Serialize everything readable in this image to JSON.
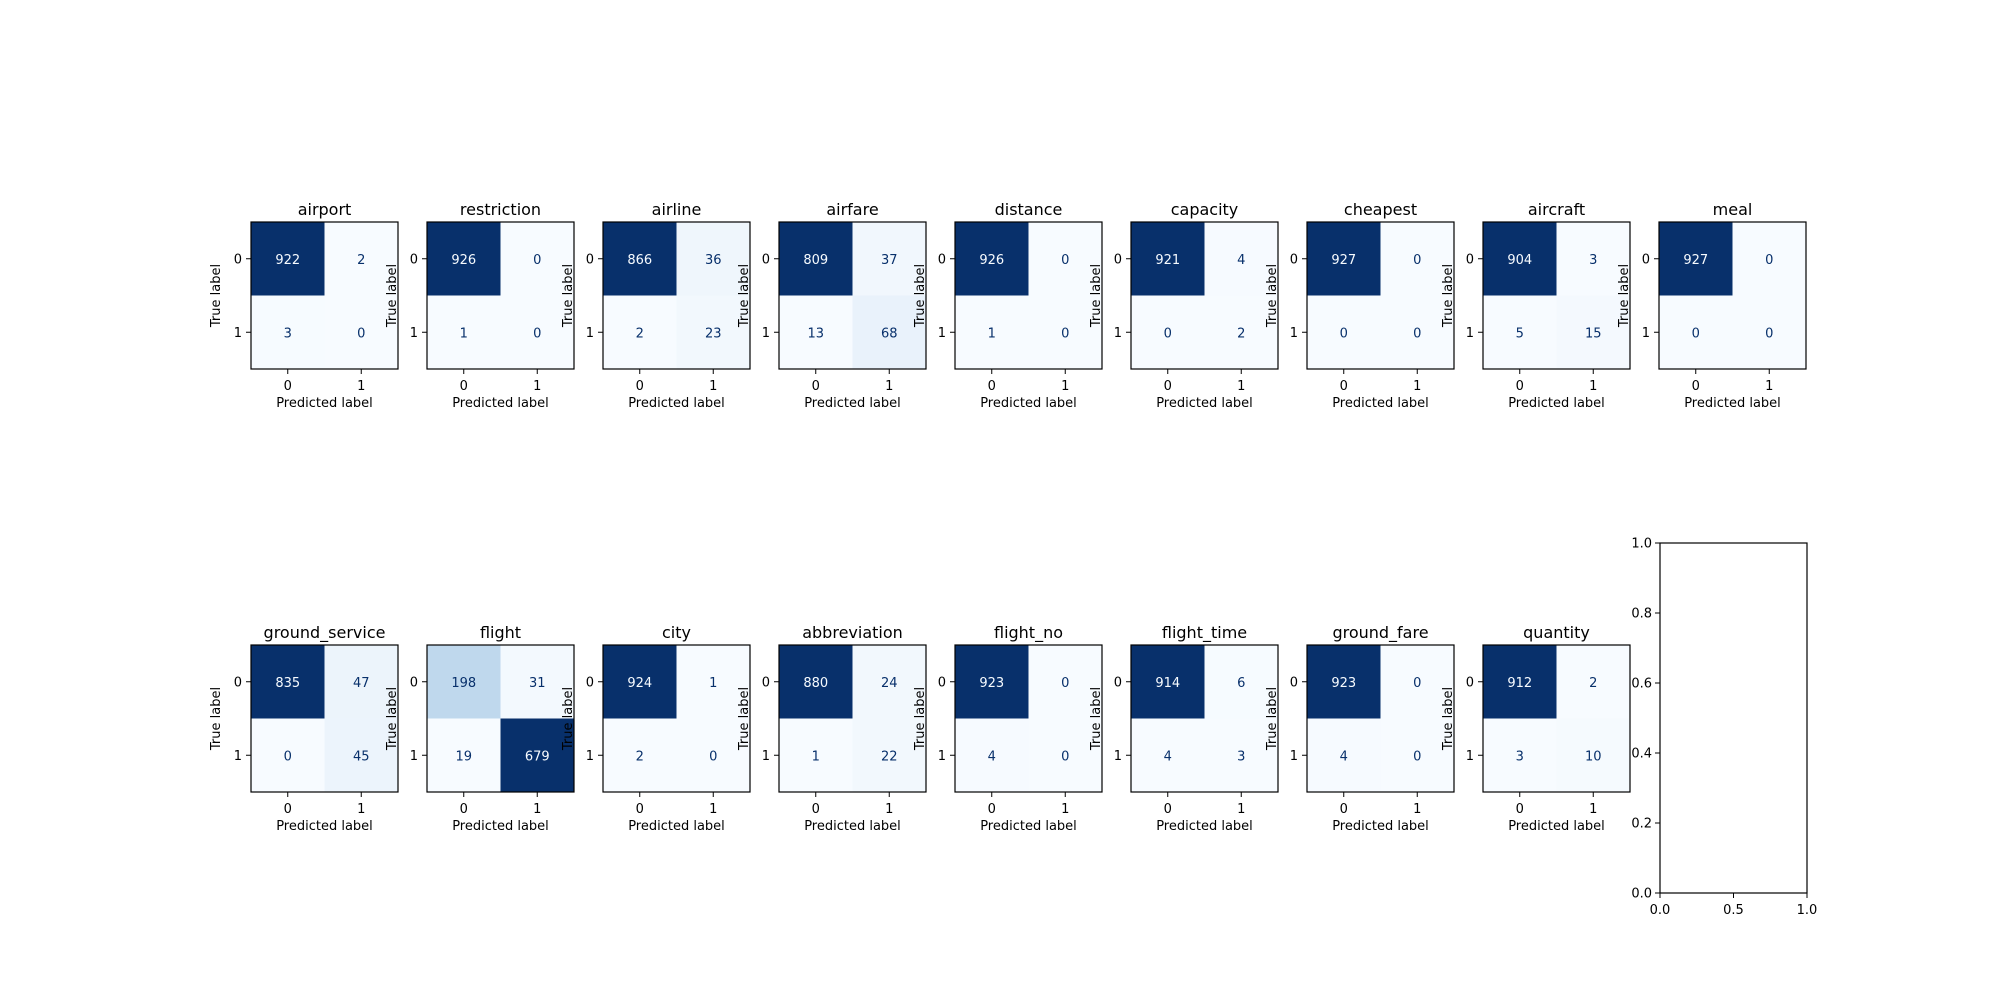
{
  "figure": {
    "colormap": "Blues",
    "cmap_low": "#f7fbff",
    "cmap_high": "#08306b",
    "text_dark": "#08306b",
    "text_light": "#f7fbff"
  },
  "chart_data": [
    {
      "type": "heatmap",
      "title": "airport",
      "xlabel": "Predicted label",
      "ylabel": "True label",
      "xticks": [
        "0",
        "1"
      ],
      "yticks": [
        "0",
        "1"
      ],
      "matrix": [
        [
          922,
          2
        ],
        [
          3,
          0
        ]
      ]
    },
    {
      "type": "heatmap",
      "title": "restriction",
      "xlabel": "Predicted label",
      "ylabel": "True label",
      "xticks": [
        "0",
        "1"
      ],
      "yticks": [
        "0",
        "1"
      ],
      "matrix": [
        [
          926,
          0
        ],
        [
          1,
          0
        ]
      ]
    },
    {
      "type": "heatmap",
      "title": "airline",
      "xlabel": "Predicted label",
      "ylabel": "True label",
      "xticks": [
        "0",
        "1"
      ],
      "yticks": [
        "0",
        "1"
      ],
      "matrix": [
        [
          866,
          36
        ],
        [
          2,
          23
        ]
      ]
    },
    {
      "type": "heatmap",
      "title": "airfare",
      "xlabel": "Predicted label",
      "ylabel": "True label",
      "xticks": [
        "0",
        "1"
      ],
      "yticks": [
        "0",
        "1"
      ],
      "matrix": [
        [
          809,
          37
        ],
        [
          13,
          68
        ]
      ]
    },
    {
      "type": "heatmap",
      "title": "distance",
      "xlabel": "Predicted label",
      "ylabel": "True label",
      "xticks": [
        "0",
        "1"
      ],
      "yticks": [
        "0",
        "1"
      ],
      "matrix": [
        [
          926,
          0
        ],
        [
          1,
          0
        ]
      ]
    },
    {
      "type": "heatmap",
      "title": "capacity",
      "xlabel": "Predicted label",
      "ylabel": "True label",
      "xticks": [
        "0",
        "1"
      ],
      "yticks": [
        "0",
        "1"
      ],
      "matrix": [
        [
          921,
          4
        ],
        [
          0,
          2
        ]
      ]
    },
    {
      "type": "heatmap",
      "title": "cheapest",
      "xlabel": "Predicted label",
      "ylabel": "True label",
      "xticks": [
        "0",
        "1"
      ],
      "yticks": [
        "0",
        "1"
      ],
      "matrix": [
        [
          927,
          0
        ],
        [
          0,
          0
        ]
      ]
    },
    {
      "type": "heatmap",
      "title": "aircraft",
      "xlabel": "Predicted label",
      "ylabel": "True label",
      "xticks": [
        "0",
        "1"
      ],
      "yticks": [
        "0",
        "1"
      ],
      "matrix": [
        [
          904,
          3
        ],
        [
          5,
          15
        ]
      ]
    },
    {
      "type": "heatmap",
      "title": "meal",
      "xlabel": "Predicted label",
      "ylabel": "True label",
      "xticks": [
        "0",
        "1"
      ],
      "yticks": [
        "0",
        "1"
      ],
      "matrix": [
        [
          927,
          0
        ],
        [
          0,
          0
        ]
      ]
    },
    {
      "type": "heatmap",
      "title": "ground_service",
      "xlabel": "Predicted label",
      "ylabel": "True label",
      "xticks": [
        "0",
        "1"
      ],
      "yticks": [
        "0",
        "1"
      ],
      "matrix": [
        [
          835,
          47
        ],
        [
          0,
          45
        ]
      ]
    },
    {
      "type": "heatmap",
      "title": "flight",
      "xlabel": "Predicted label",
      "ylabel": "True label",
      "xticks": [
        "0",
        "1"
      ],
      "yticks": [
        "0",
        "1"
      ],
      "matrix": [
        [
          198,
          31
        ],
        [
          19,
          679
        ]
      ]
    },
    {
      "type": "heatmap",
      "title": "city",
      "xlabel": "Predicted label",
      "ylabel": "True label",
      "xticks": [
        "0",
        "1"
      ],
      "yticks": [
        "0",
        "1"
      ],
      "matrix": [
        [
          924,
          1
        ],
        [
          2,
          0
        ]
      ]
    },
    {
      "type": "heatmap",
      "title": "abbreviation",
      "xlabel": "Predicted label",
      "ylabel": "True label",
      "xticks": [
        "0",
        "1"
      ],
      "yticks": [
        "0",
        "1"
      ],
      "matrix": [
        [
          880,
          24
        ],
        [
          1,
          22
        ]
      ]
    },
    {
      "type": "heatmap",
      "title": "flight_no",
      "xlabel": "Predicted label",
      "ylabel": "True label",
      "xticks": [
        "0",
        "1"
      ],
      "yticks": [
        "0",
        "1"
      ],
      "matrix": [
        [
          923,
          0
        ],
        [
          4,
          0
        ]
      ]
    },
    {
      "type": "heatmap",
      "title": "flight_time",
      "xlabel": "Predicted label",
      "ylabel": "True label",
      "xticks": [
        "0",
        "1"
      ],
      "yticks": [
        "0",
        "1"
      ],
      "matrix": [
        [
          914,
          6
        ],
        [
          4,
          3
        ]
      ]
    },
    {
      "type": "heatmap",
      "title": "ground_fare",
      "xlabel": "Predicted label",
      "ylabel": "True label",
      "xticks": [
        "0",
        "1"
      ],
      "yticks": [
        "0",
        "1"
      ],
      "matrix": [
        [
          923,
          0
        ],
        [
          4,
          0
        ]
      ]
    },
    {
      "type": "heatmap",
      "title": "quantity",
      "xlabel": "Predicted label",
      "ylabel": "True label",
      "xticks": [
        "0",
        "1"
      ],
      "yticks": [
        "0",
        "1"
      ],
      "matrix": [
        [
          912,
          2
        ],
        [
          3,
          10
        ]
      ]
    },
    {
      "type": "line",
      "title": "",
      "empty": true,
      "xlim": [
        0.0,
        1.0
      ],
      "ylim": [
        0.0,
        1.0
      ],
      "xticks": [
        "0.0",
        "0.5",
        "1.0"
      ],
      "yticks": [
        "0.0",
        "0.2",
        "0.4",
        "0.6",
        "0.8",
        "1.0"
      ]
    }
  ]
}
